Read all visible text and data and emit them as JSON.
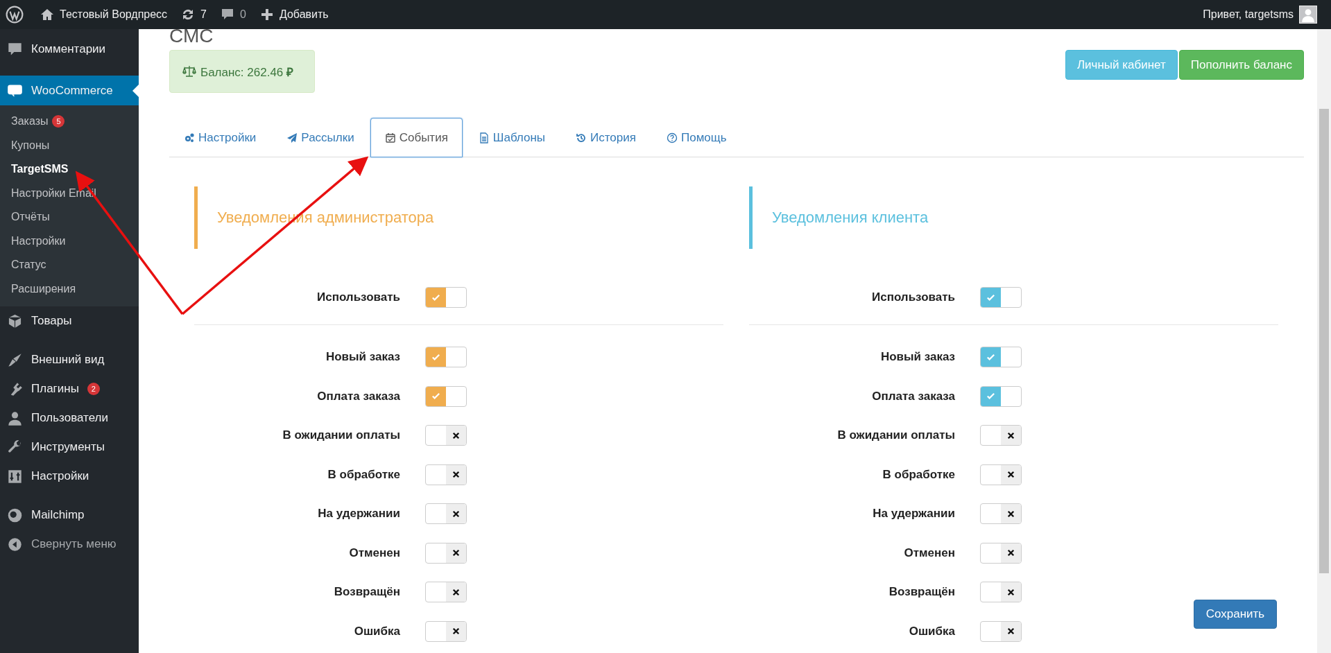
{
  "admin_bar": {
    "site_name": "Тестовый Вордпресс",
    "updates": "7",
    "comments": "0",
    "add_new": "Добавить",
    "greeting": "Привет, targetsms"
  },
  "sidebar": {
    "items": [
      {
        "label": "Комментарии",
        "current": false
      },
      {
        "label": "WooCommerce",
        "current": true,
        "submenu": [
          {
            "label": "Заказы",
            "badge": "5",
            "selected": false
          },
          {
            "label": "Купоны",
            "selected": false
          },
          {
            "label": "TargetSMS",
            "selected": true
          },
          {
            "label": "Настройки Email",
            "selected": false
          },
          {
            "label": "Отчёты",
            "selected": false
          },
          {
            "label": "Настройки",
            "selected": false
          },
          {
            "label": "Статус",
            "selected": false
          },
          {
            "label": "Расширения",
            "selected": false
          }
        ]
      },
      {
        "label": "Товары",
        "current": false
      },
      {
        "label": "Внешний вид",
        "current": false
      },
      {
        "label": "Плагины",
        "badge": "2",
        "current": false
      },
      {
        "label": "Пользователи",
        "current": false
      },
      {
        "label": "Инструменты",
        "current": false
      },
      {
        "label": "Настройки",
        "current": false
      },
      {
        "label": "Mailchimp",
        "current": false
      },
      {
        "label": "Свернуть меню",
        "current": false
      }
    ]
  },
  "page": {
    "title": "СМС",
    "balance": "Баланс: 262.46 **₽**",
    "buttons": [
      "Личный кабинет",
      "Пополнить баланс"
    ]
  },
  "tabs": [
    {
      "label": "Настройки",
      "selected": false
    },
    {
      "label": "Рассылки",
      "selected": false
    },
    {
      "label": "События",
      "selected": true
    },
    {
      "label": "Шаблоны",
      "selected": false
    },
    {
      "label": "История",
      "selected": false
    },
    {
      "label": "Помощь",
      "selected": false
    }
  ],
  "sections": [
    {
      "title": "Уведомления администратора",
      "color": "#f0ad4e",
      "enable": {
        "label": "Использовать",
        "on": true
      },
      "events": [
        {
          "label": "Новый заказ",
          "on": true
        },
        {
          "label": "Оплата заказа",
          "on": true
        },
        {
          "label": "В ожидании оплаты",
          "on": false
        },
        {
          "label": "В обработке",
          "on": false
        },
        {
          "label": "На удержании",
          "on": false
        },
        {
          "label": "Отменен",
          "on": false
        },
        {
          "label": "Возвращён",
          "on": false
        },
        {
          "label": "Ошибка",
          "on": false
        }
      ]
    },
    {
      "title": "Уведомления клиента",
      "color": "#5bc0de",
      "enable": {
        "label": "Использовать",
        "on": true
      },
      "events": [
        {
          "label": "Новый заказ",
          "on": true
        },
        {
          "label": "Оплата заказа",
          "on": true
        },
        {
          "label": "В ожидании оплаты",
          "on": false
        },
        {
          "label": "В обработке",
          "on": false
        },
        {
          "label": "На удержании",
          "on": false
        },
        {
          "label": "Отменен",
          "on": false
        },
        {
          "label": "Возвращён",
          "on": false
        },
        {
          "label": "Ошибка",
          "on": false
        }
      ]
    }
  ],
  "save_button": "Сохранить"
}
